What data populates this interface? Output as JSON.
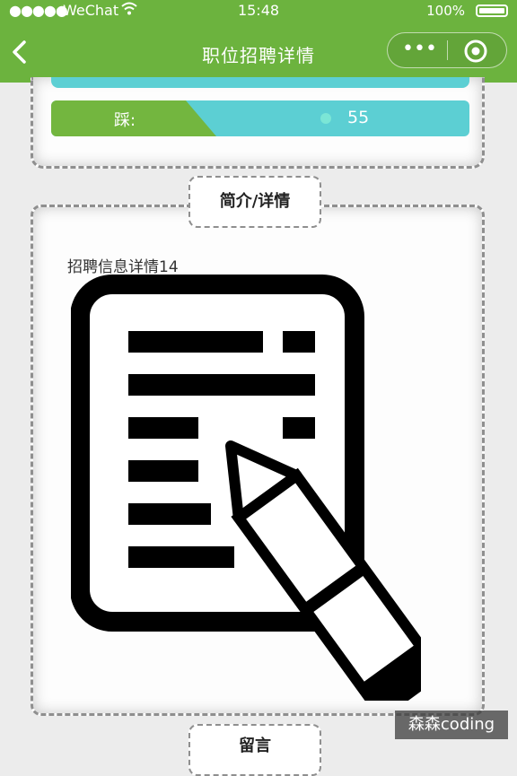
{
  "status_bar": {
    "signal": "●●●●●",
    "carrier": "WeChat",
    "time": "15:48",
    "battery": "100%"
  },
  "nav": {
    "title": "职位招聘详情",
    "more_label": "•••"
  },
  "progress": {
    "label": "踩:",
    "value": "55"
  },
  "tabs": {
    "intro": "简介/详情",
    "message": "留言"
  },
  "detail": {
    "title": "招聘信息详情14"
  },
  "watermark": "森森coding",
  "colors": {
    "nav_green": "#6cb33e",
    "bar_green": "#73b63f",
    "bar_teal": "#5ccfd3",
    "background": "#ececec"
  },
  "icons": [
    "back-chevron-icon",
    "more-dots-icon",
    "target-circle-icon",
    "document-edit-icon",
    "wifi-icon",
    "battery-icon"
  ]
}
